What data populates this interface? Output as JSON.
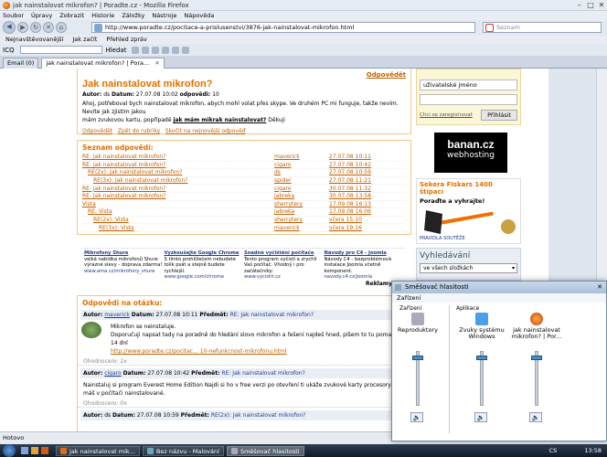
{
  "window": {
    "title": "jak nainstalovat mikrofon? | Poradte.cz - Mozilla Firefox"
  },
  "menu": [
    "Soubor",
    "Úpravy",
    "Zobrazit",
    "Historie",
    "Záložky",
    "Nástroje",
    "Nápověda"
  ],
  "nav": {
    "url": "http://www.poradte.cz/pocitace-a-prislusenstvi/3876-jak-nainstalovat-mikrofon.html",
    "search_placeholder": "Seznam"
  },
  "bookmarks": [
    "Nejnavštěvovanější",
    "Jak začít",
    "Přehled zpráv"
  ],
  "toolbar2": {
    "icq": "ICQ",
    "hledat": "Hledat"
  },
  "tabs": [
    {
      "label": "Email (0)"
    },
    {
      "label": "jak nainstalovat mikrofon? | Pora..."
    }
  ],
  "question": {
    "odpovedet": "Odpovědět",
    "title": "Jak nainstalovat mikrofon?",
    "meta_autor": "Autor:",
    "autor": "ds",
    "meta_datum": "Datum:",
    "datum": "27.07.08 10:02",
    "meta_odp": "odpovědi:",
    "odp": "10",
    "body1": "Ahoj, potřeboval bych nainstalovat mikrofon, abych mohl volat přes skype. Ve druhém PC mi funguje, takže nevím. Nevíte jak zjistím jakou",
    "body2": "mám zvukovou kartu, popřípadě",
    "body_link": "jak mám mikrak nainstalovat?",
    "body3": "Děkuji",
    "links": [
      "Odpovědět",
      "Zpět do rubriky",
      "Skočit na nejnovější odpověď"
    ]
  },
  "answers_list": {
    "title": "Seznam odpovědí:",
    "rows": [
      {
        "t": "RE: Jak nainstalovat mikrofon?",
        "a": "maverick",
        "d": "27.07.08 10:11",
        "i": 0
      },
      {
        "t": "RE: Jak nainstalovat mikrofon?",
        "a": "cigaro",
        "d": "27.07.08 10:42",
        "i": 0
      },
      {
        "t": "RE(2x): Jak nainstalovat mikrofon?",
        "a": "ds",
        "d": "27.07.08 10:59",
        "i": 1
      },
      {
        "t": "RE(3x): Jak nainstalovat mikrofon?",
        "a": "spider",
        "d": "27.07.08 11:21",
        "i": 2
      },
      {
        "t": "RE: Jak nainstalovat mikrofon?",
        "a": "cigaro",
        "d": "30.07.08 11:32",
        "i": 0
      },
      {
        "t": "RE: Jak nainstalovat mikrofon?",
        "a": "jabreka",
        "d": "30.07.08 13:58",
        "i": 0
      },
      {
        "t": "Vista",
        "a": "sherrytery",
        "d": "17.09.08 16:13",
        "i": 0
      },
      {
        "t": "RE: Vista",
        "a": "jabreka",
        "d": "17.09.08 16:06",
        "i": 1
      },
      {
        "t": "RE(2x): Vista",
        "a": "sherrytery",
        "d": "včera 15:10",
        "i": 2
      },
      {
        "t": "RE(3x): Vista",
        "a": "maverick",
        "d": "včera 19:16",
        "i": 3
      }
    ]
  },
  "ads": [
    {
      "h": "Mikrofony Shure",
      "b": "velká nabídka mikrofonů Shure výrazné slevy - doprava zdarma!",
      "u": "www.ama.cz/mikrofony_shure"
    },
    {
      "h": "Vyzkoušejte Google Chrome",
      "b": "S tímto prohlížečem nebudete tolik psát a stejně budete rychlejší.",
      "u": "www.google.com/chrome"
    },
    {
      "h": "Snadné vyčištění počítače",
      "b": "Tento program vyčistí a zrychlí Vaš počítač. Vhodný i pro začátečníky:",
      "u": "www.vycistit.cz"
    },
    {
      "h": "Návody pro C4 - Joomla",
      "b": "Návody C4 - bezproblémová instalace Joomla včetně komponent.",
      "u": "navody.c4.cz/joomla"
    }
  ],
  "reklamy": "Reklamy G",
  "answers": {
    "title": "Odpovědi na otázku:",
    "a1": {
      "autor": "maverick",
      "datum": "27.07.08 10:11",
      "predmet": "RE: Jak nainstalovat mikrofon?",
      "p1": "Mikrofon se neinstaluje.",
      "p2": "Doporučuji napsat tady na poradně do hledání slovo mikrofon a řešení najdeš hned, píšem to tu pomalu co 14 dní",
      "l": "http://www.poradte.cz/pocitac... 10-nefunkcnost-mikrofonu.html",
      "rating": "Ohodnocero: 2x"
    },
    "a2": {
      "autor": "cigaro",
      "datum": "27.07.08 10:42",
      "predmet": "RE: Jak nainstalovat mikrofon?",
      "p1": "Nainstaluj si program Everest Home Edition Najdi si ho v free verzi po otevření ti ukáže zvukové karty procesory",
      "p2": "máš v počítači nainstalované.",
      "rating": "Ohodnocero: 0x"
    },
    "a3": {
      "autor": "ds",
      "datum": "27.07.08 10:59",
      "predmet": "RE(2x): Jak nainstalovat mikrofon?"
    },
    "odp": "odpo"
  },
  "sidebar": {
    "username_placeholder": "uživatelské jméno",
    "forgot": "Chci se zaregistrovat",
    "login": "Přihlásit",
    "banan1": "banan.cz",
    "banan2": "webhosting",
    "sekera_title": "Sekera Fiskars 1400 štípací",
    "sekera_sub": "Poraďte a vyhrajte!",
    "sekera_badge": "PRAVIDLA SOUTĚŽE",
    "search_title": "Vyhledávání",
    "search_scope": "ve všech složkách"
  },
  "status": "Hotovo",
  "taskbar": {
    "items": [
      "jak nainstalovat mik...",
      "Bez názvu - Malování",
      "Směšovač hlasitosti"
    ],
    "lang": "CS",
    "time": "13:58"
  },
  "mixer": {
    "title": "Směšovač hlasitosti",
    "menu": "Zařízení",
    "dev_label": "Zařízení",
    "apps_label": "Aplikace",
    "ch": [
      {
        "name": "Reproduktory"
      },
      {
        "name": "Zvuky systému Windows"
      },
      {
        "name": "jak nainstalovat mikrofon? | Por..."
      }
    ],
    "levels": [
      0.92,
      0.92,
      0.92
    ]
  }
}
